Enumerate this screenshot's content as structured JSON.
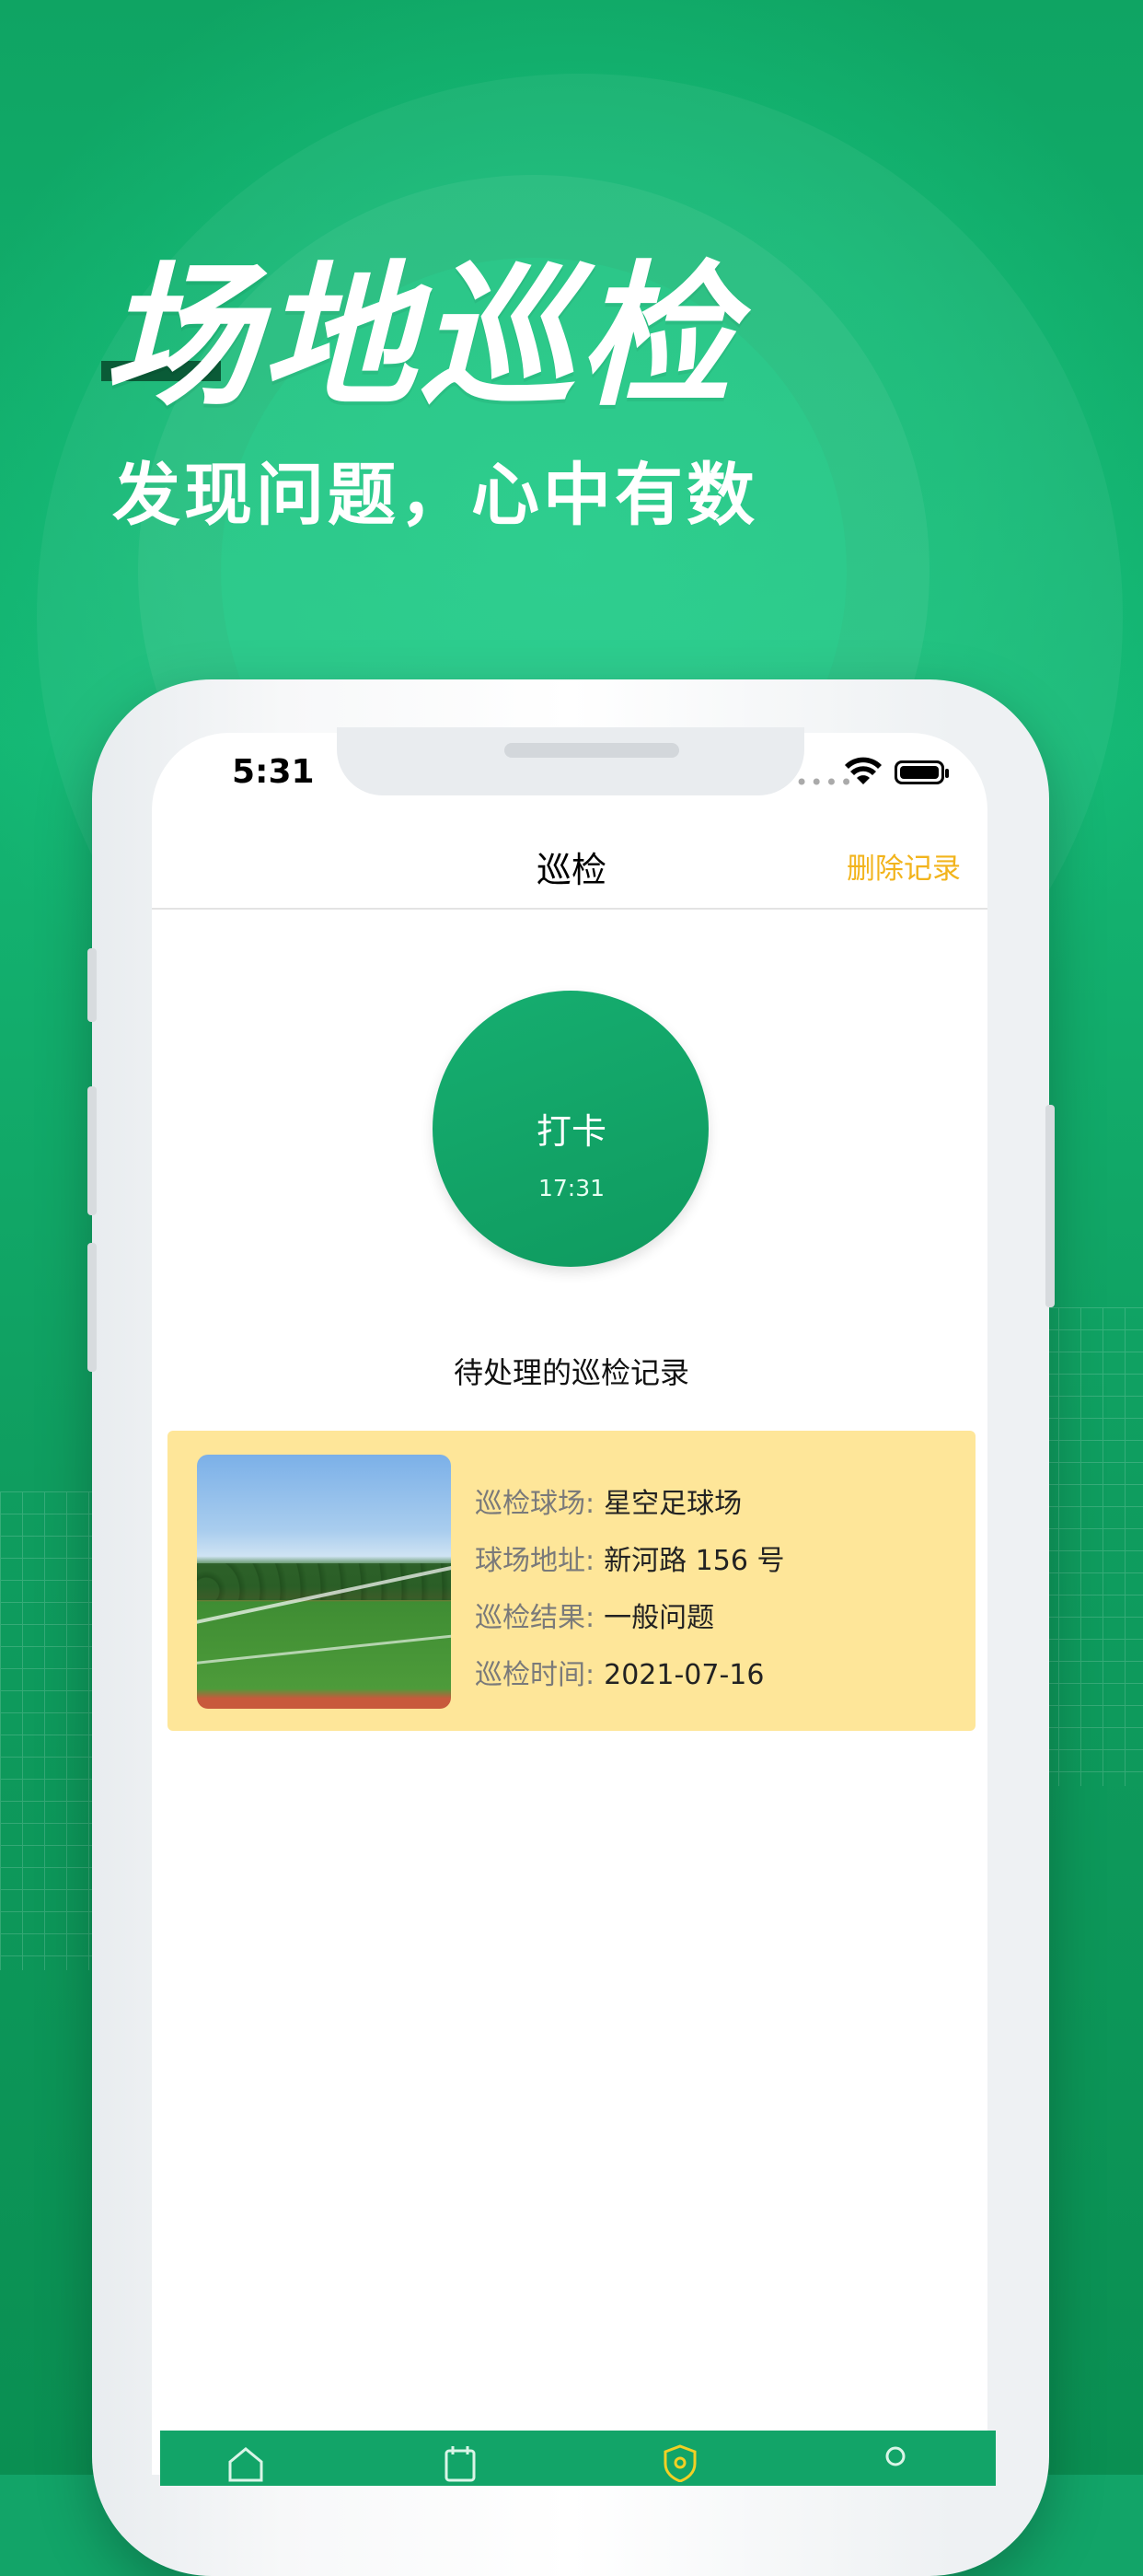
{
  "headline": "场地巡检",
  "subhead": "发现问题，心中有数",
  "status_bar": {
    "time": "5:31"
  },
  "nav": {
    "title": "巡检",
    "action": "删除记录"
  },
  "checkin": {
    "label": "打卡",
    "time": "17:31"
  },
  "section_title": "待处理的巡检记录",
  "record": {
    "venue_label": "巡检球场:",
    "venue": "星空足球场",
    "address_label": "球场地址:",
    "address": "新河路 156 号",
    "result_label": "巡检结果:",
    "result": "一般问题",
    "time_label": "巡检时间:",
    "time": "2021-07-16"
  },
  "colors": {
    "brand_green": "#12a468",
    "accent_yellow": "#f2b41c",
    "card_bg": "#fee699"
  },
  "tabs": [
    {
      "icon": "home-icon"
    },
    {
      "icon": "calendar-icon"
    },
    {
      "icon": "shield-icon"
    },
    {
      "icon": "user-icon"
    }
  ]
}
